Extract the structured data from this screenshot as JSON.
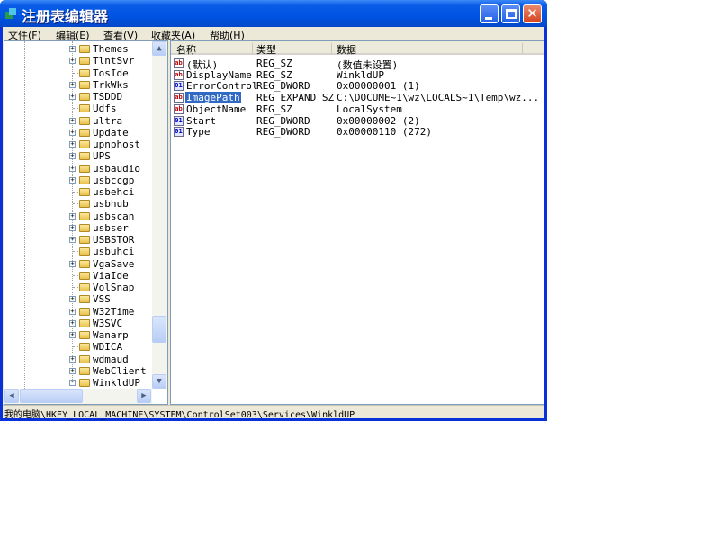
{
  "window": {
    "title": "注册表编辑器"
  },
  "menu": [
    "文件(F)",
    "编辑(E)",
    "查看(V)",
    "收藏夹(A)",
    "帮助(H)"
  ],
  "tree": [
    {
      "label": "Themes",
      "exp": "+"
    },
    {
      "label": "TlntSvr",
      "exp": "+"
    },
    {
      "label": "TosIde",
      "exp": ""
    },
    {
      "label": "TrkWks",
      "exp": "+"
    },
    {
      "label": "TSDDD",
      "exp": "+"
    },
    {
      "label": "Udfs",
      "exp": ""
    },
    {
      "label": "ultra",
      "exp": "+"
    },
    {
      "label": "Update",
      "exp": "+"
    },
    {
      "label": "upnphost",
      "exp": "+"
    },
    {
      "label": "UPS",
      "exp": "+"
    },
    {
      "label": "usbaudio",
      "exp": "+"
    },
    {
      "label": "usbccgp",
      "exp": "+"
    },
    {
      "label": "usbehci",
      "exp": ""
    },
    {
      "label": "usbhub",
      "exp": ""
    },
    {
      "label": "usbscan",
      "exp": "+"
    },
    {
      "label": "usbser",
      "exp": "+"
    },
    {
      "label": "USBSTOR",
      "exp": "+"
    },
    {
      "label": "usbuhci",
      "exp": ""
    },
    {
      "label": "VgaSave",
      "exp": "+"
    },
    {
      "label": "ViaIde",
      "exp": ""
    },
    {
      "label": "VolSnap",
      "exp": ""
    },
    {
      "label": "VSS",
      "exp": "+"
    },
    {
      "label": "W32Time",
      "exp": "+"
    },
    {
      "label": "W3SVC",
      "exp": "+"
    },
    {
      "label": "Wanarp",
      "exp": "+"
    },
    {
      "label": "WDICA",
      "exp": ""
    },
    {
      "label": "wdmaud",
      "exp": "+"
    },
    {
      "label": "WebClient",
      "exp": "+"
    },
    {
      "label": "WinkldUP",
      "exp": "-"
    }
  ],
  "list": {
    "headers": {
      "name": "名称",
      "type": "类型",
      "data": "数据"
    },
    "rows": [
      {
        "name": "(默认)",
        "type": "REG_SZ",
        "data": "(数值未设置)",
        "kind": "sz"
      },
      {
        "name": "DisplayName",
        "type": "REG_SZ",
        "data": "WinkldUP",
        "kind": "sz"
      },
      {
        "name": "ErrorControl",
        "type": "REG_DWORD",
        "data": "0x00000001 (1)",
        "kind": "dw"
      },
      {
        "name": "ImagePath",
        "type": "REG_EXPAND_SZ",
        "data": "C:\\DOCUME~1\\wz\\LOCALS~1\\Temp\\wz...",
        "kind": "sz",
        "selected": true
      },
      {
        "name": "ObjectName",
        "type": "REG_SZ",
        "data": "LocalSystem",
        "kind": "sz"
      },
      {
        "name": "Start",
        "type": "REG_DWORD",
        "data": "0x00000002 (2)",
        "kind": "dw"
      },
      {
        "name": "Type",
        "type": "REG_DWORD",
        "data": "0x00000110 (272)",
        "kind": "dw"
      }
    ]
  },
  "status": "我的电脑\\HKEY_LOCAL_MACHINE\\SYSTEM\\ControlSet003\\Services\\WinkldUP"
}
